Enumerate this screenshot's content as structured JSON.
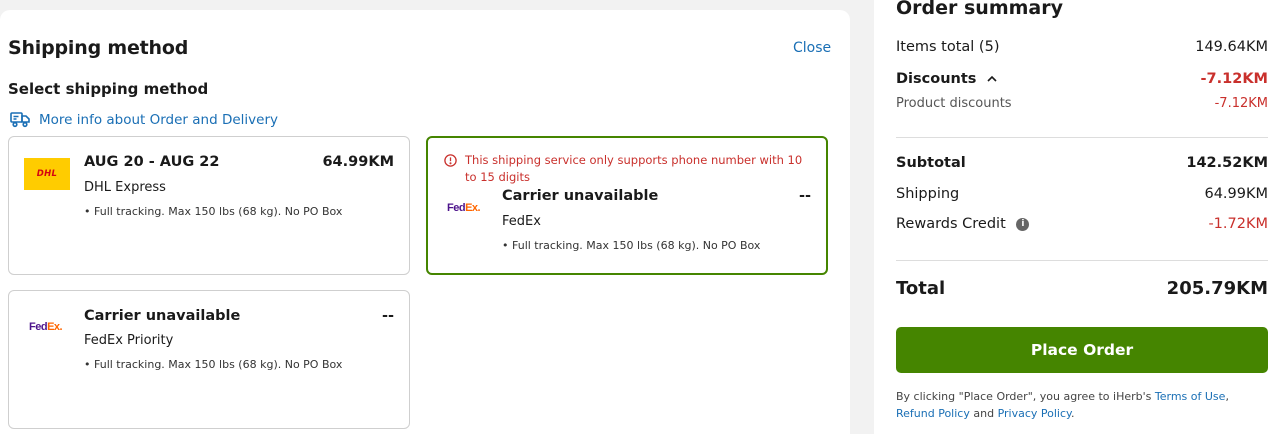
{
  "shipping": {
    "title": "Shipping method",
    "close_label": "Close",
    "subtitle": "Select shipping method",
    "more_info_label": "More info about Order and Delivery",
    "options": [
      {
        "carrier_logo": "dhl-logo",
        "logo_text": "DHL",
        "title": "AUG 20 - AUG 22",
        "price": "64.99KM",
        "name": "DHL Express",
        "feature": "Full tracking. Max 150 lbs (68 kg). No PO Box",
        "selected": false
      },
      {
        "carrier_logo": "fedex-logo",
        "logo_text_a": "Fed",
        "logo_text_b": "Ex.",
        "warning": "This shipping service only supports phone number with 10 to 15 digits",
        "title": "Carrier unavailable",
        "price": "--",
        "name": "FedEx",
        "feature": "Full tracking. Max 150 lbs (68 kg). No PO Box",
        "selected": true
      },
      {
        "carrier_logo": "fedex-logo",
        "logo_text_a": "Fed",
        "logo_text_b": "Ex.",
        "title": "Carrier unavailable",
        "price": "--",
        "name": "FedEx Priority",
        "feature": "Full tracking. Max 150 lbs (68 kg). No PO Box",
        "selected": false
      }
    ]
  },
  "summary": {
    "title": "Order summary",
    "items_total_label": "Items total (5)",
    "items_total_value": "149.64KM",
    "discounts_label": "Discounts",
    "discounts_value": "-7.12KM",
    "product_discounts_label": "Product discounts",
    "product_discounts_value": "-7.12KM",
    "subtotal_label": "Subtotal",
    "subtotal_value": "142.52KM",
    "shipping_label": "Shipping",
    "shipping_value": "64.99KM",
    "rewards_label": "Rewards Credit",
    "rewards_value": "-1.72KM",
    "total_label": "Total",
    "total_value": "205.79KM",
    "place_order_label": "Place Order",
    "legal_prefix": "By clicking \"Place Order\", you agree to iHerb's ",
    "terms_label": "Terms of Use",
    "legal_sep": ", ",
    "refund_label": "Refund Policy",
    "legal_and": " and ",
    "privacy_label": "Privacy Policy",
    "legal_end": "."
  },
  "colors": {
    "accent_green": "#458500",
    "link_blue": "#1a6fb5",
    "error_red": "#c9302c",
    "dhl_yellow": "#ffcc00"
  }
}
